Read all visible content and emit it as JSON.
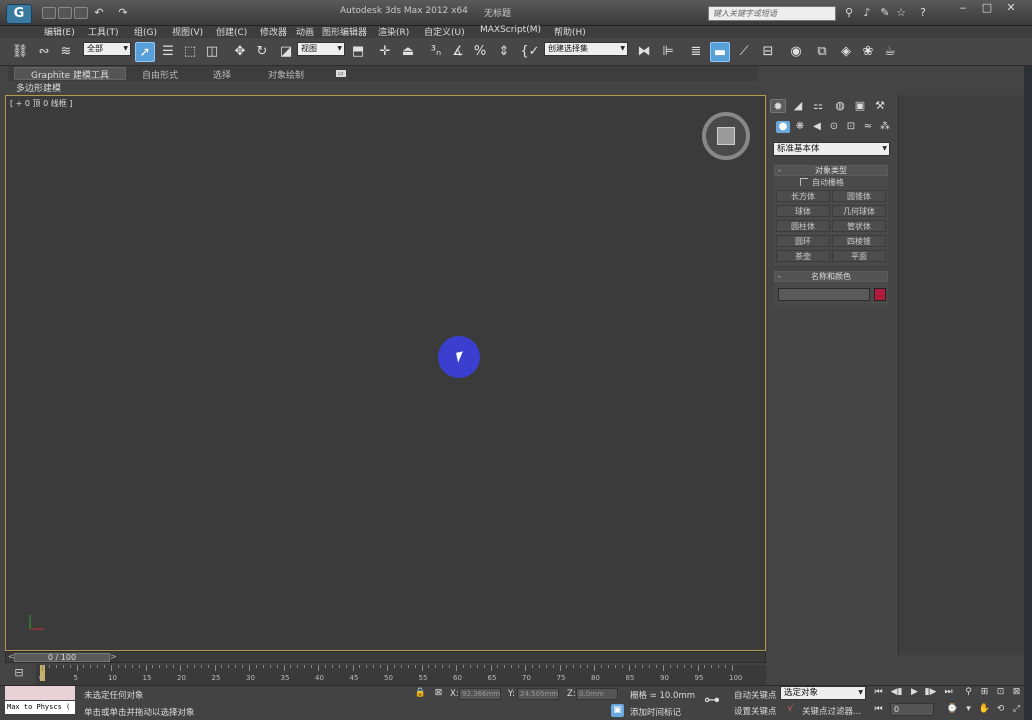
{
  "app": {
    "title": "Autodesk 3ds Max  2012 x64",
    "doc_title": "无标题",
    "logo_icon": "3dsmax-logo-icon",
    "search_placeholder": "键入关键字或短语"
  },
  "menu": [
    {
      "label": "编辑(E)"
    },
    {
      "label": "工具(T)"
    },
    {
      "label": "组(G)"
    },
    {
      "label": "视图(V)"
    },
    {
      "label": "创建(C)"
    },
    {
      "label": "修改器"
    },
    {
      "label": "动画"
    },
    {
      "label": "图形编辑器"
    },
    {
      "label": "渲染(R)"
    },
    {
      "label": "自定义(U)"
    },
    {
      "label": "MAXScript(M)"
    },
    {
      "label": "帮助(H)"
    }
  ],
  "toolbar": {
    "selection_filter": "全部",
    "ref_coord": "视图",
    "named_selection": "创建选择集"
  },
  "ribbon": {
    "tabs": [
      {
        "label": "Graphite 建模工具"
      },
      {
        "label": "自由形式"
      },
      {
        "label": "选择"
      },
      {
        "label": "对象绘制"
      }
    ],
    "sub_label": "多边形建模"
  },
  "viewport": {
    "label": "[ + 0 顶 0 线框 ]"
  },
  "command_panel": {
    "dropdown": "标准基本体",
    "object_type": {
      "header": "对象类型",
      "autogrid": "自动栅格",
      "buttons": [
        {
          "label": "长方体"
        },
        {
          "label": "圆锥体"
        },
        {
          "label": "球体"
        },
        {
          "label": "几何球体"
        },
        {
          "label": "圆柱体"
        },
        {
          "label": "管状体"
        },
        {
          "label": "圆环"
        },
        {
          "label": "四棱锥"
        },
        {
          "label": "茶壶"
        },
        {
          "label": "平面"
        }
      ]
    },
    "name_color": {
      "header": "名称和颜色",
      "swatch_color": "#b21a3c"
    }
  },
  "timeline": {
    "frame": "0 / 100",
    "ticks": [
      "0",
      "5",
      "10",
      "15",
      "20",
      "25",
      "30",
      "35",
      "40",
      "45",
      "50",
      "55",
      "60",
      "65",
      "70",
      "75",
      "80",
      "85",
      "90",
      "95",
      "100"
    ]
  },
  "status": {
    "maxscript": "Max to Physcs (",
    "selection": "未选定任何对象",
    "prompt": "单击或单击并拖动以选择对象",
    "x_label": "X:",
    "x_value": "92.366mm",
    "y_label": "Y:",
    "y_value": "24.505mm",
    "z_label": "Z:",
    "z_value": "0.0mm",
    "grid": "栅格 = 10.0mm",
    "add_time_tag": "添加时间标记",
    "auto_key": "自动关键点",
    "set_key": "设置关键点",
    "selected_dropdown": "选定对象",
    "key_filters": "关键点过滤器...",
    "frame_field": "0"
  }
}
